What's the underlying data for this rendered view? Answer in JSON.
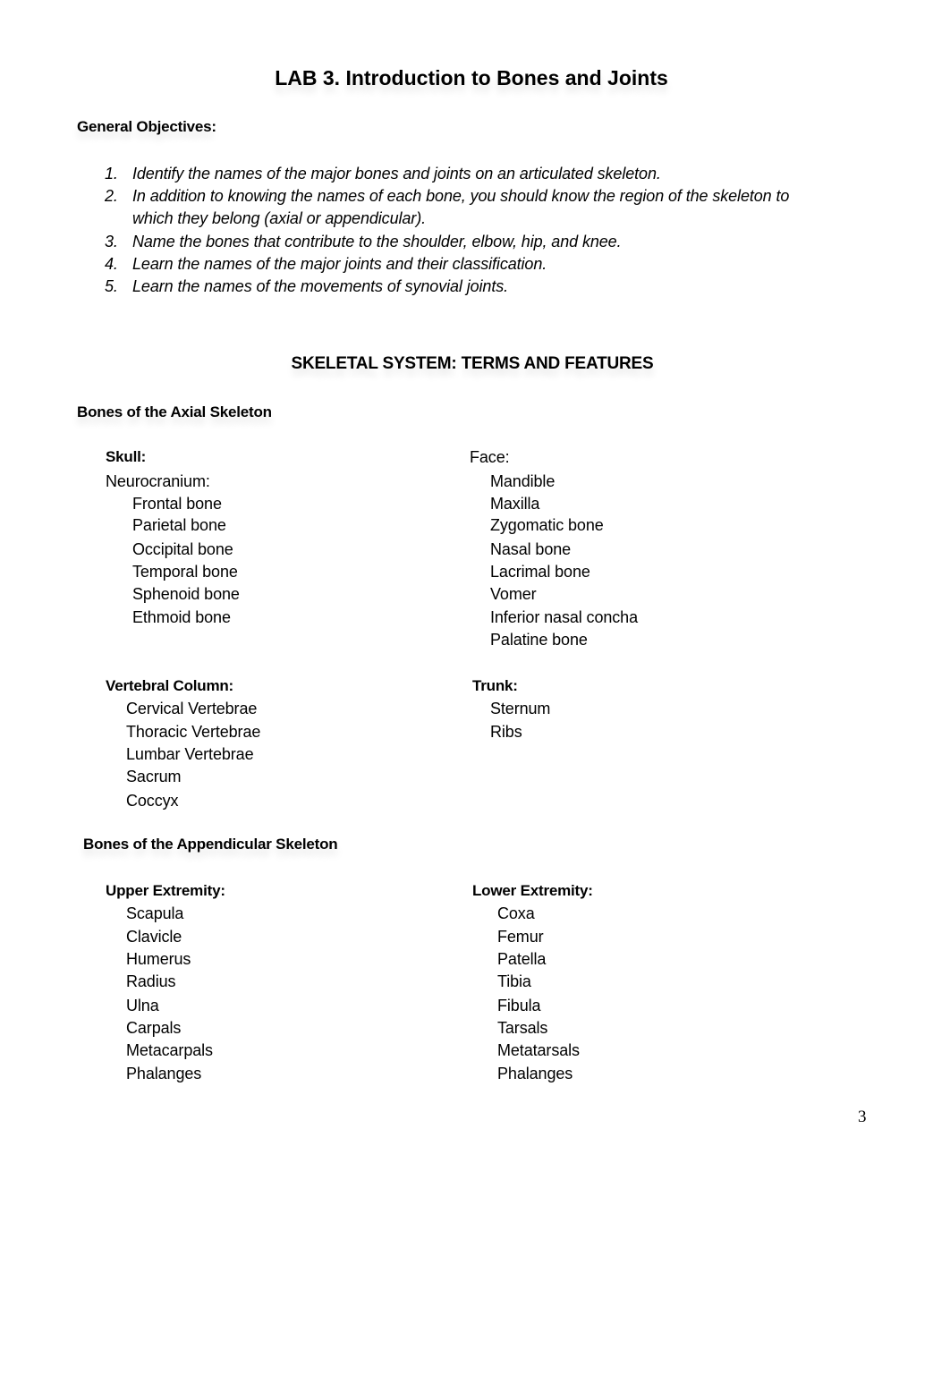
{
  "title": "LAB 3. Introduction to Bones and Joints",
  "general_objectives": {
    "heading": "General Objectives:",
    "items": [
      {
        "num": "1.",
        "lines": [
          "Identify the names of the major bones and joints on an articulated skeleton."
        ]
      },
      {
        "num": "2.",
        "lines": [
          "In addition to knowing the names of each bone, you should know the region of the skeleton to",
          "which they belong (axial or appendicular)."
        ]
      },
      {
        "num": "3.",
        "lines": [
          "Name the bones that contribute to the shoulder, elbow, hip, and knee."
        ]
      },
      {
        "num": "4.",
        "lines": [
          "Learn the names of the major joints and their classification."
        ]
      },
      {
        "num": "5.",
        "lines": [
          "Learn the names of the movements of synovial joints."
        ]
      }
    ]
  },
  "section_title": "SKELETAL SYSTEM: TERMS AND FEATURES",
  "axial": {
    "heading": "Bones of the Axial Skeleton",
    "skull": {
      "heading": "Skull:",
      "neurocranium_label": "Neurocranium:",
      "neurocranium": [
        "Frontal bone",
        "Parietal bone",
        "Occipital bone",
        "Temporal bone",
        "Sphenoid bone",
        "Ethmoid bone"
      ]
    },
    "face": {
      "heading": "Face:",
      "items": [
        "Mandible",
        "Maxilla",
        "Zygomatic bone",
        "Nasal bone",
        "Lacrimal bone",
        "Vomer",
        "Inferior nasal concha",
        "Palatine bone"
      ]
    },
    "vertebral_column": {
      "heading": "Vertebral Column:",
      "items": [
        "Cervical Vertebrae",
        "Thoracic Vertebrae",
        "Lumbar Vertebrae",
        "Sacrum",
        "Coccyx"
      ]
    },
    "trunk": {
      "heading": "Trunk:",
      "items": [
        "Sternum",
        "Ribs"
      ]
    }
  },
  "appendicular": {
    "heading": "Bones of the Appendicular Skeleton",
    "upper": {
      "heading": "Upper Extremity:",
      "items": [
        "Scapula",
        "Clavicle",
        "Humerus",
        "Radius",
        "Ulna",
        "Carpals",
        "Metacarpals",
        "Phalanges"
      ]
    },
    "lower": {
      "heading": "Lower Extremity:",
      "items": [
        "Coxa",
        "Femur",
        "Patella",
        "Tibia",
        "Fibula",
        "Tarsals",
        "Metatarsals",
        "Phalanges"
      ]
    }
  },
  "page_number": "3"
}
